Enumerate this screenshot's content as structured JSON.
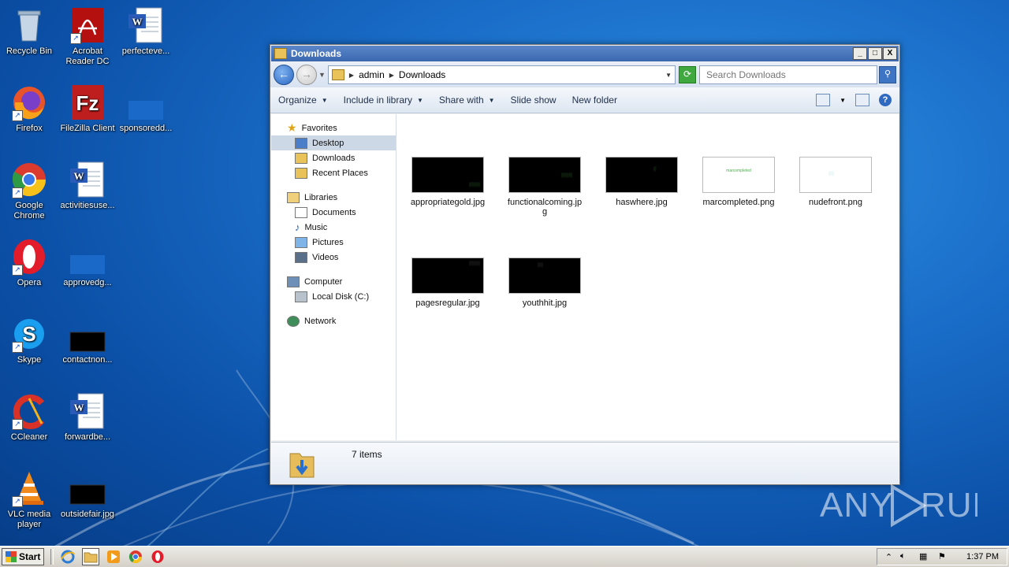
{
  "desktop": {
    "icons": [
      {
        "label": "Recycle Bin",
        "icon": "recycle-bin-icon"
      },
      {
        "label": "Acrobat Reader DC",
        "icon": "acrobat-icon"
      },
      {
        "label": "perfecteve...",
        "icon": "word-doc-icon"
      },
      {
        "label": "Firefox",
        "icon": "firefox-icon"
      },
      {
        "label": "FileZilla Client",
        "icon": "filezilla-icon"
      },
      {
        "label": "sponsoredd...",
        "icon": "image-file-icon"
      },
      {
        "label": "Google Chrome",
        "icon": "chrome-icon"
      },
      {
        "label": "activitiesuse...",
        "icon": "word-doc-icon"
      },
      {
        "label": "Opera",
        "icon": "opera-icon"
      },
      {
        "label": "approvedg...",
        "icon": "image-file-icon"
      },
      {
        "label": "Skype",
        "icon": "skype-icon"
      },
      {
        "label": "contactnon...",
        "icon": "image-file-icon"
      },
      {
        "label": "CCleaner",
        "icon": "ccleaner-icon"
      },
      {
        "label": "forwardbe...",
        "icon": "word-doc-icon"
      },
      {
        "label": "VLC media player",
        "icon": "vlc-icon"
      },
      {
        "label": "outsidefair.jpg",
        "icon": "image-file-icon"
      }
    ]
  },
  "window": {
    "title": "Downloads",
    "buttons": {
      "minimize": "_",
      "maximize": "□",
      "close": "X"
    },
    "address": {
      "crumbs": [
        "admin",
        "Downloads"
      ]
    },
    "search": {
      "placeholder": "Search Downloads"
    },
    "toolbar": {
      "organize": "Organize",
      "include_in_library": "Include in library",
      "share_with": "Share with",
      "slide_show": "Slide show",
      "new_folder": "New folder"
    },
    "nav": {
      "favorites": {
        "label": "Favorites",
        "items": [
          "Desktop",
          "Downloads",
          "Recent Places"
        ]
      },
      "libraries": {
        "label": "Libraries",
        "items": [
          "Documents",
          "Music",
          "Pictures",
          "Videos"
        ]
      },
      "computer": {
        "label": "Computer",
        "items": [
          "Local Disk (C:)"
        ]
      },
      "network": {
        "label": "Network"
      }
    },
    "files": [
      {
        "name": "appropriategold.jpg",
        "thumb": "dark"
      },
      {
        "name": "functionalcoming.jpg",
        "thumb": "dark"
      },
      {
        "name": "haswhere.jpg",
        "thumb": "dark"
      },
      {
        "name": "marcompleted.png",
        "thumb": "light",
        "thumb_text": "marcompleted"
      },
      {
        "name": "nudefront.png",
        "thumb": "light"
      },
      {
        "name": "pagesregular.jpg",
        "thumb": "dark"
      },
      {
        "name": "youthhit.jpg",
        "thumb": "dark"
      }
    ],
    "status": {
      "items": "7 items"
    }
  },
  "watermark": "ANY RUN",
  "taskbar": {
    "start": "Start",
    "clock": "1:37 PM"
  }
}
